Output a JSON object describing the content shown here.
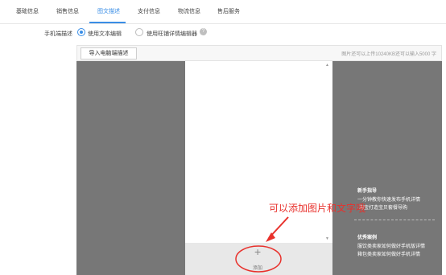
{
  "tabs": [
    {
      "label": "基础信息"
    },
    {
      "label": "销售信息"
    },
    {
      "label": "图文描述"
    },
    {
      "label": "支付信息"
    },
    {
      "label": "物流信息"
    },
    {
      "label": "售后服务"
    }
  ],
  "active_tab": "图文描述",
  "mobile_desc": {
    "label": "手机端描述",
    "option1": "使用文本编辑",
    "option2": "使用旺铺详情编辑器",
    "selected": "使用文本编辑"
  },
  "toolbar": {
    "import_label": "导入电脑端描述",
    "quota_text": "图片还可以上传10240KB还可以输入5000 字"
  },
  "editor": {
    "add_symbol": "+",
    "add_label": "添加"
  },
  "guide": {
    "title1": "新手指导",
    "line1": "一分钟教你快速发布手机详情",
    "line2": "·淘宝打造宝贝套餐导购",
    "title2": "优秀案例",
    "line3": "服饮类卖家如何做好手机版详情",
    "line4": "箱包类卖家如何做好手机详情"
  },
  "annotation": {
    "text": "可以添加图片和文字哦",
    "color": "#e8312c"
  },
  "colors": {
    "accent": "#3a8ee6",
    "editor_bg": "#777777"
  },
  "icons": {
    "help": "question-icon",
    "scroll_up": "arrow-up-icon",
    "scroll_down": "arrow-down-icon",
    "add": "plus-icon"
  }
}
